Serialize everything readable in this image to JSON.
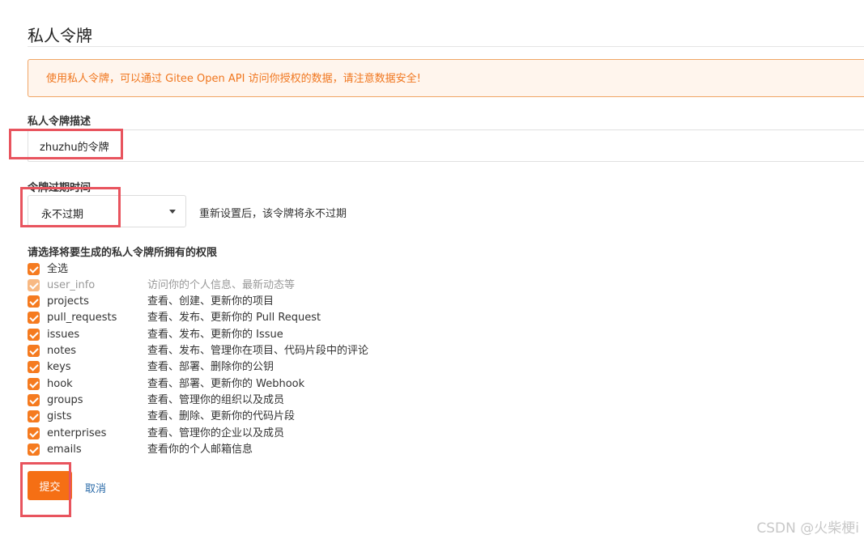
{
  "page": {
    "title": "私人令牌",
    "notice": "使用私人令牌，可以通过 Gitee Open API 访问你授权的数据，请注意数据安全!"
  },
  "form": {
    "description_label": "私人令牌描述",
    "description_value": "zhuzhu的令牌",
    "expiry_label": "令牌过期时间",
    "expiry_selected": "永不过期",
    "expiry_hint": "重新设置后，该令牌将永不过期",
    "permissions_label": "请选择将要生成的私人令牌所拥有的权限",
    "permissions": [
      {
        "name": "全选",
        "desc": "",
        "checked": true,
        "disabled": false
      },
      {
        "name": "user_info",
        "desc": "访问你的个人信息、最新动态等",
        "checked": true,
        "disabled": true
      },
      {
        "name": "projects",
        "desc": "查看、创建、更新你的项目",
        "checked": true,
        "disabled": false
      },
      {
        "name": "pull_requests",
        "desc": "查看、发布、更新你的 Pull Request",
        "checked": true,
        "disabled": false
      },
      {
        "name": "issues",
        "desc": "查看、发布、更新你的 Issue",
        "checked": true,
        "disabled": false
      },
      {
        "name": "notes",
        "desc": "查看、发布、管理你在项目、代码片段中的评论",
        "checked": true,
        "disabled": false
      },
      {
        "name": "keys",
        "desc": "查看、部署、删除你的公钥",
        "checked": true,
        "disabled": false
      },
      {
        "name": "hook",
        "desc": "查看、部署、更新你的 Webhook",
        "checked": true,
        "disabled": false
      },
      {
        "name": "groups",
        "desc": "查看、管理你的组织以及成员",
        "checked": true,
        "disabled": false
      },
      {
        "name": "gists",
        "desc": "查看、删除、更新你的代码片段",
        "checked": true,
        "disabled": false
      },
      {
        "name": "enterprises",
        "desc": "查看、管理你的企业以及成员",
        "checked": true,
        "disabled": false
      },
      {
        "name": "emails",
        "desc": "查看你的个人邮箱信息",
        "checked": true,
        "disabled": false
      }
    ],
    "submit_label": "提交",
    "cancel_label": "取消"
  },
  "watermark": "CSDN @火柴梗i",
  "colors": {
    "accent": "#f56f14",
    "highlight": "#e8545e",
    "notice_text": "#f0761e"
  }
}
